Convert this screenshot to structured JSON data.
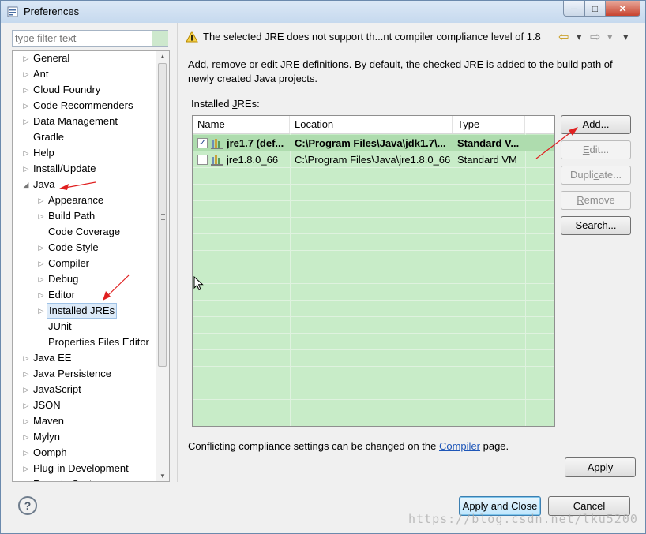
{
  "window": {
    "title": "Preferences",
    "icon": "preferences-icon",
    "controls": {
      "minimize": "─",
      "maximize": "□",
      "close": "✕"
    }
  },
  "sidebar": {
    "filter_placeholder": "type filter text",
    "items": [
      {
        "label": "General",
        "expander": "▷",
        "level": 0
      },
      {
        "label": "Ant",
        "expander": "▷",
        "level": 0
      },
      {
        "label": "Cloud Foundry",
        "expander": "▷",
        "level": 0
      },
      {
        "label": "Code Recommenders",
        "expander": "▷",
        "level": 0
      },
      {
        "label": "Data Management",
        "expander": "▷",
        "level": 0
      },
      {
        "label": "Gradle",
        "expander": "",
        "level": 0
      },
      {
        "label": "Help",
        "expander": "▷",
        "level": 0
      },
      {
        "label": "Install/Update",
        "expander": "▷",
        "level": 0
      },
      {
        "label": "Java",
        "expander": "◢",
        "level": 0
      },
      {
        "label": "Appearance",
        "expander": "▷",
        "level": 1
      },
      {
        "label": "Build Path",
        "expander": "▷",
        "level": 1
      },
      {
        "label": "Code Coverage",
        "expander": "",
        "level": 1
      },
      {
        "label": "Code Style",
        "expander": "▷",
        "level": 1
      },
      {
        "label": "Compiler",
        "expander": "▷",
        "level": 1
      },
      {
        "label": "Debug",
        "expander": "▷",
        "level": 1
      },
      {
        "label": "Editor",
        "expander": "▷",
        "level": 1
      },
      {
        "label": "Installed JREs",
        "expander": "▷",
        "level": 1,
        "selected": true
      },
      {
        "label": "JUnit",
        "expander": "",
        "level": 1
      },
      {
        "label": "Properties Files Editor",
        "expander": "",
        "level": 1
      },
      {
        "label": "Java EE",
        "expander": "▷",
        "level": 0
      },
      {
        "label": "Java Persistence",
        "expander": "▷",
        "level": 0
      },
      {
        "label": "JavaScript",
        "expander": "▷",
        "level": 0
      },
      {
        "label": "JSON",
        "expander": "▷",
        "level": 0
      },
      {
        "label": "Maven",
        "expander": "▷",
        "level": 0
      },
      {
        "label": "Mylyn",
        "expander": "▷",
        "level": 0
      },
      {
        "label": "Oomph",
        "expander": "▷",
        "level": 0
      },
      {
        "label": "Plug-in Development",
        "expander": "▷",
        "level": 0
      },
      {
        "label": "Remote Systems",
        "expander": "▷",
        "level": 0
      }
    ]
  },
  "header": {
    "message": "The selected JRE does not support th...nt compiler compliance level of 1.8",
    "back_icon": "⇦",
    "back_menu": "▾",
    "forward_icon": "⇨",
    "forward_menu": "▾",
    "view_menu": "▾"
  },
  "main": {
    "description": "Add, remove or edit JRE definitions. By default, the checked JRE is added to the build path of newly created Java projects.",
    "installed_label_pre": "Installed ",
    "installed_label_mn": "J",
    "installed_label_post": "REs:",
    "columns": [
      "Name",
      "Location",
      "Type"
    ],
    "rows": [
      {
        "checked": true,
        "check_mark": "✓",
        "name": "jre1.7 (def...",
        "location": "C:\\Program Files\\Java\\jdk1.7\\...",
        "type": "Standard V..."
      },
      {
        "checked": false,
        "check_mark": "",
        "name": "jre1.8.0_66",
        "location": "C:\\Program Files\\Java\\jre1.8.0_66",
        "type": "Standard VM"
      }
    ],
    "buttons": {
      "add": {
        "mn": "A",
        "rest": "dd..."
      },
      "edit": {
        "mn": "E",
        "rest": "dit..."
      },
      "duplicate": {
        "pre": "Dupli",
        "mn": "c",
        "rest": "ate..."
      },
      "remove": {
        "mn": "R",
        "rest": "emove"
      },
      "search": {
        "mn": "S",
        "rest": "earch..."
      }
    },
    "conflict_pre": "Conflicting compliance settings can be changed on the ",
    "conflict_link": "Compiler",
    "conflict_post": " page.",
    "apply": {
      "mn": "A",
      "rest": "pply"
    }
  },
  "footer": {
    "help": "?",
    "apply_close": "Apply and Close",
    "cancel": "Cancel",
    "watermark": "https://blog.csdn.net/lku5200"
  },
  "colors": {
    "table_bg": "#c8ecc8",
    "selected_row": "#aedcae",
    "annotation_arrow": "#e02020",
    "link": "#1e56b8"
  }
}
